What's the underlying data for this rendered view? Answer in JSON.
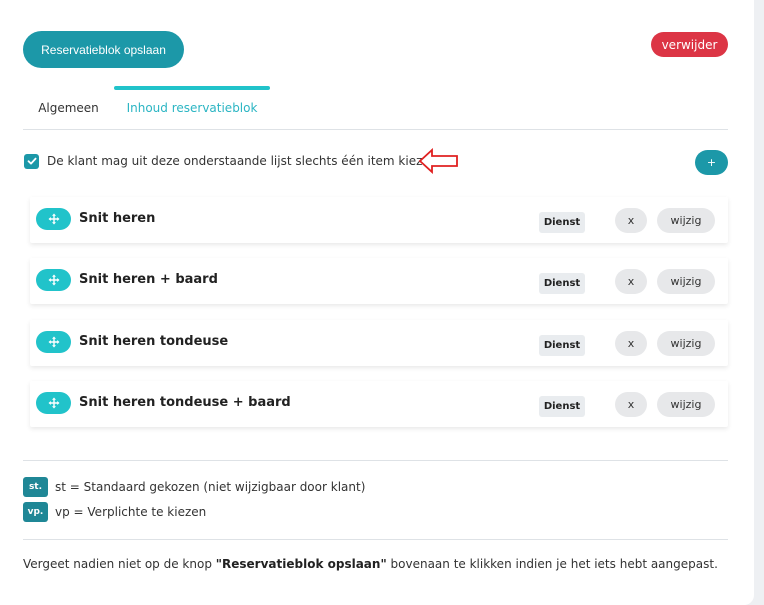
{
  "toolbar": {
    "save_label": "Reservatieblok opslaan",
    "delete_label": "verwijder"
  },
  "tabs": [
    {
      "label": "Algemeen",
      "active": false
    },
    {
      "label": "Inhoud reservatieblok",
      "active": true
    }
  ],
  "single_choice": {
    "checked": true,
    "label": "De klant mag uit deze onderstaande lijst slechts één item kiezen."
  },
  "add_label": "+",
  "items": [
    {
      "name": "Snit heren",
      "type": "Dienst",
      "remove_label": "x",
      "edit_label": "wijzig"
    },
    {
      "name": "Snit heren + baard",
      "type": "Dienst",
      "remove_label": "x",
      "edit_label": "wijzig"
    },
    {
      "name": "Snit heren tondeuse",
      "type": "Dienst",
      "remove_label": "x",
      "edit_label": "wijzig"
    },
    {
      "name": "Snit heren tondeuse + baard",
      "type": "Dienst",
      "remove_label": "x",
      "edit_label": "wijzig"
    }
  ],
  "legend": [
    {
      "badge": "st.",
      "text": "st = Standaard gekozen (niet wijzigbaar door klant)"
    },
    {
      "badge": "vp.",
      "text": "vp = Verplichte te kiezen"
    }
  ],
  "footer": {
    "before": "Vergeet nadien niet op de knop ",
    "bold": "\"Reservatieblok opslaan\"",
    "after": " bovenaan te klikken indien je het iets hebt aangepast."
  },
  "colors": {
    "primary": "#1c98a8",
    "accent": "#21c3ca",
    "danger": "#dc3545",
    "annotation_arrow": "#e02020"
  },
  "icons": {
    "drag": "move-arrows-icon",
    "check": "check-icon",
    "annotation": "arrow-left-icon"
  }
}
